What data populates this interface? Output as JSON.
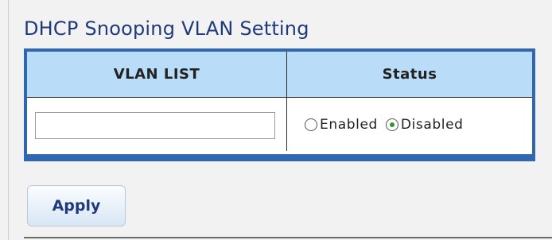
{
  "page": {
    "title": "DHCP Snooping VLAN Setting"
  },
  "table": {
    "headers": {
      "vlan_list": "VLAN LIST",
      "status": "Status"
    },
    "row": {
      "vlan_list_value": "",
      "status_options": [
        {
          "label": "Enabled",
          "checked": false
        },
        {
          "label": "Disabled",
          "checked": true
        }
      ]
    }
  },
  "actions": {
    "apply_label": "Apply"
  },
  "colors": {
    "title": "#1f3a7a",
    "header_bg": "#b9dcf9",
    "border_accent": "#2f68b0",
    "radio_checked": "#2e9a2e"
  }
}
